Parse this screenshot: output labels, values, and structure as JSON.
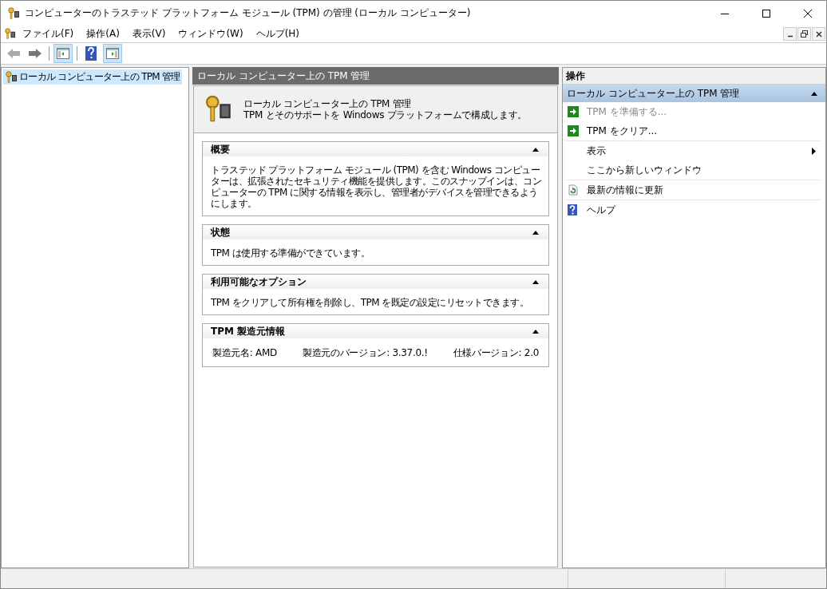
{
  "window": {
    "title": "コンピューターのトラステッド プラットフォーム モジュール (TPM) の管理 (ローカル コンピューター)"
  },
  "menu": [
    "ファイル(F)",
    "操作(A)",
    "表示(V)",
    "ウィンドウ(W)",
    "ヘルプ(H)"
  ],
  "toolbar": [
    {
      "kind": "back",
      "disabled": true
    },
    {
      "kind": "forward",
      "disabled": false
    },
    {
      "kind": "tree-pane",
      "pressed": true
    },
    {
      "kind": "help",
      "pressed": false
    },
    {
      "kind": "action-pane",
      "pressed": true
    }
  ],
  "tree": [
    {
      "label": "ローカル コンピューター上の TPM 管理",
      "selected": true
    }
  ],
  "center": {
    "header": "ローカル コンピューター上の TPM 管理",
    "banner_title": "ローカル コンピューター上の TPM 管理",
    "banner_text": "TPM とそのサポートを Windows プラットフォームで構成します。",
    "sections": [
      {
        "title": "概要",
        "expanded": true,
        "lines": [
          "トラステッド プラットフォーム モジュール (TPM) を含む Windows コンピューターは、拡張されたセキュリティ機能を提供します。このスナップインは、コンピューターの TPM に関する情報を表示し、管理者がデバイスを管理できるようにします。"
        ]
      },
      {
        "title": "状態",
        "expanded": true,
        "lines": [
          "TPM は使用する準備ができています。"
        ]
      },
      {
        "title": "利用可能なオプション",
        "expanded": true,
        "lines": [
          "TPM をクリアして所有権を削除し、TPM を既定の設定にリセットできます。"
        ]
      },
      {
        "title": "TPM 製造元情報",
        "expanded": true,
        "fields": [
          "製造元名: AMD",
          "製造元のバージョン: 3.37.0.!",
          "仕様バージョン: 2.0"
        ]
      }
    ]
  },
  "actions": {
    "header": "操作",
    "group_title": "ローカル コンピューター上の TPM 管理",
    "expanded": true,
    "groups": [
      [
        {
          "label": "TPM を準備する...",
          "kind": "arrow",
          "disabled": true,
          "submenu": false
        },
        {
          "label": "TPM をクリア...",
          "kind": "arrow",
          "disabled": false,
          "submenu": false
        }
      ],
      [
        {
          "label": "表示",
          "kind": "plain",
          "disabled": false,
          "submenu": true
        },
        {
          "label": "ここから新しいウィンドウ",
          "kind": "plain",
          "disabled": false,
          "submenu": false
        }
      ],
      [
        {
          "label": "最新の情報に更新",
          "kind": "refresh",
          "disabled": false,
          "submenu": false
        }
      ],
      [
        {
          "label": "ヘルプ",
          "kind": "help",
          "disabled": false,
          "submenu": false
        }
      ]
    ]
  }
}
